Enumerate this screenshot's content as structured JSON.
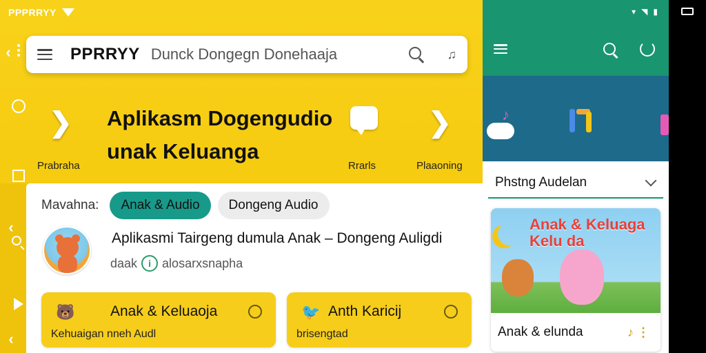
{
  "left_app": {
    "status": {
      "carrier": "PPPRRYY"
    },
    "search": {
      "title": "PPRRYY",
      "subtitle": "Dunck Dongegn Donehaaja",
      "search_icon": "search-icon",
      "mic_icon": "mic-icon"
    },
    "hero": {
      "title": "Aplikasm Dogengudio unak Keluanga",
      "left_label": "Prabraha",
      "right_label_1": "Rrarls",
      "right_label_2": "Plaaoning"
    },
    "filter": {
      "label": "Mavahna:",
      "chips": [
        "Anak & Audio",
        "Dongeng Audio"
      ]
    },
    "song": {
      "title": "Aplikasmi Tairgeng dumula Anak – Dongeng Auligdi",
      "meta_prefix": "daak",
      "meta_suffix": "alosarxsnapha"
    },
    "tiles": [
      {
        "title": "Anak & Keluaoja",
        "subtitle": "Kehuaigan nneh Audl",
        "icon": "bear-icon"
      },
      {
        "title": "Anth Karicij",
        "subtitle": "brisengtad",
        "icon": "bird-icon"
      }
    ]
  },
  "right_app": {
    "dropdown_label": "Phstng Audelan",
    "card": {
      "title": "Anak & Keluaga Kelu da",
      "footer": "Anak & elunda"
    }
  },
  "colors": {
    "left_bg": "#f6cb10",
    "teal": "#19956f",
    "chip_active": "#189a8a"
  }
}
